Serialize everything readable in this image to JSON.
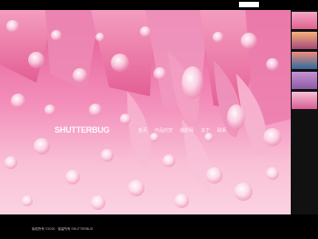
{
  "search": {
    "placeholder": ""
  },
  "hero": {
    "image": "pink-flower-petals-with-water-droplets",
    "logo_text": "SHUTTERBUG"
  },
  "nav": {
    "items": [
      {
        "label": "首页"
      },
      {
        "label": "作品欣赏"
      },
      {
        "label": "摄影师"
      },
      {
        "label": "关于"
      },
      {
        "label": "联系"
      }
    ]
  },
  "thumbnails": [
    {
      "name": "pink-petals-thumb",
      "color_top": "#f5a7c4",
      "color_bottom": "#e0608f"
    },
    {
      "name": "sunset-thumb",
      "color_top": "#f4b27a",
      "color_bottom": "#a7487a"
    },
    {
      "name": "sunset-water-thumb",
      "color_top": "#ef8d7e",
      "color_bottom": "#2f6a9e"
    },
    {
      "name": "purple-flowers-thumb",
      "color_top": "#c694d2",
      "color_bottom": "#8b5aa6"
    },
    {
      "name": "pink-tulip-thumb",
      "color_top": "#f7c0d6",
      "color_bottom": "#d75d92"
    }
  ],
  "footer": {
    "copyright": "版权所有 ©2015 · 保留所有 SHUTTERBUG"
  },
  "colors": {
    "hero_light": "#f8b5cf",
    "hero_mid": "#f07fad",
    "hero_deep": "#d9457f",
    "background": "#000000"
  }
}
